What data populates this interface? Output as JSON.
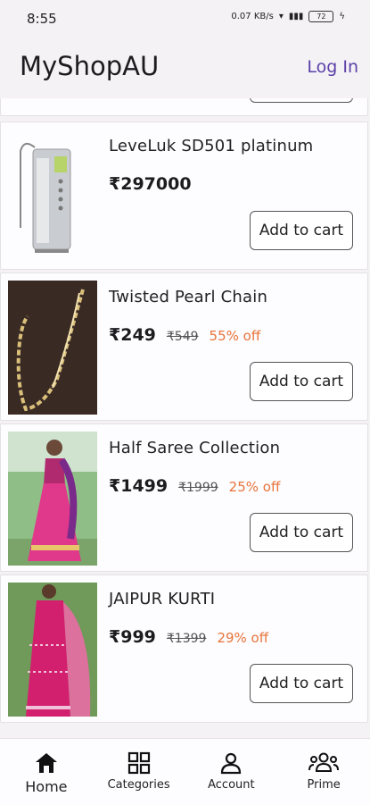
{
  "status": {
    "time": "8:55",
    "net": "0.07 KB/s",
    "battery": "72"
  },
  "appbar": {
    "title": "MyShopAU",
    "login": "Log In"
  },
  "products": [
    {
      "name": "LeveLuk SD501 platinum",
      "price": "₹297000",
      "mrp": "",
      "off": "",
      "cart": "Add to cart"
    },
    {
      "name": "Twisted Pearl Chain",
      "price": "₹249",
      "mrp": "₹549",
      "off": "55% off",
      "cart": "Add to cart"
    },
    {
      "name": "Half Saree Collection",
      "price": "₹1499",
      "mrp": "₹1999",
      "off": "25% off",
      "cart": "Add to cart"
    },
    {
      "name": "JAIPUR KURTI",
      "price": "₹999",
      "mrp": "₹1399",
      "off": "29% off",
      "cart": "Add to cart"
    }
  ],
  "nav": {
    "home": "Home",
    "categories": "Categories",
    "account": "Account",
    "prime": "Prime"
  },
  "colors": {
    "accent": "#5b3fa8",
    "discount": "#e8743b"
  }
}
